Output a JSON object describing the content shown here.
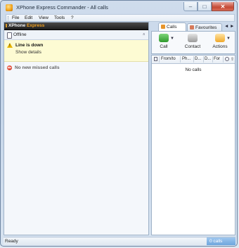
{
  "window": {
    "title": "XPhone Express Commander - All calls",
    "minimize": "–",
    "maximize": "□",
    "close": "✕"
  },
  "menu": [
    "File",
    "Edit",
    "View",
    "Tools",
    "?"
  ],
  "left_panel": {
    "header_prefix": "XPhone",
    "header_accent": "Express",
    "status": "Offline",
    "collapse_glyph": "»",
    "warning_title": "Line is down",
    "warning_link": "Show details",
    "missed_calls": "No new missed calls"
  },
  "right_panel": {
    "tabs": [
      {
        "label": "Calls",
        "icon": "calls-icon",
        "active": true
      },
      {
        "label": "Favourites",
        "icon": "favourites-icon",
        "active": false
      }
    ],
    "tab_left": "◄",
    "tab_right": "►",
    "tools": [
      {
        "label": "Call",
        "icon": "phone-icon",
        "color": "#3fae3c"
      },
      {
        "label": "Contact",
        "icon": "contact-icon",
        "color": "#9a9a9a"
      },
      {
        "label": "Actions",
        "icon": "actions-icon",
        "color": "#f2b33d"
      }
    ],
    "dropdown_glyph": "▼",
    "columns": [
      "From/to",
      "Ph...",
      "D...",
      "D...",
      "For"
    ],
    "empty_text": "No calls"
  },
  "statusbar": {
    "text": "Ready",
    "count": "0 calls"
  }
}
